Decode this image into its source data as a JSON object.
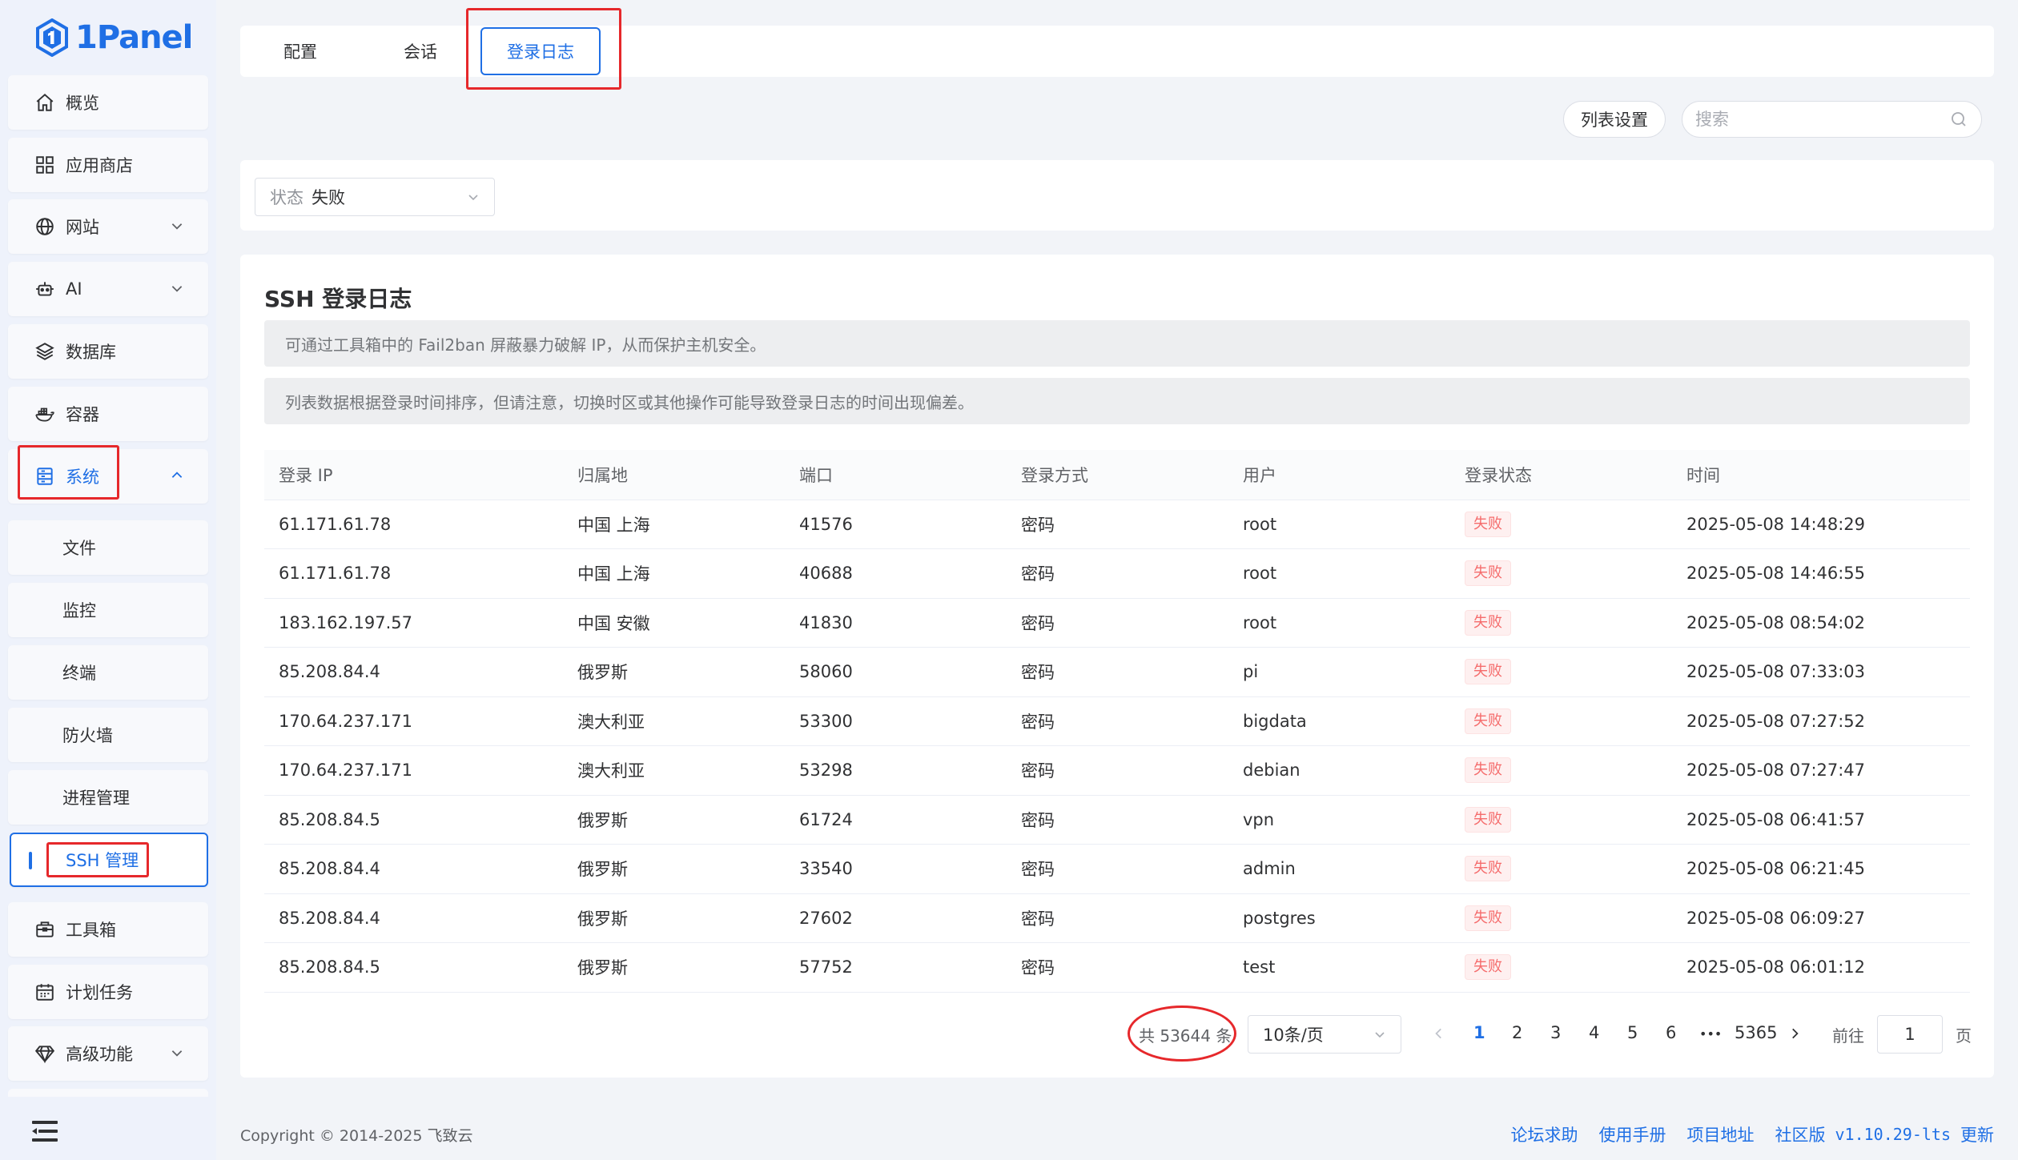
{
  "app": {
    "logo_text": "1Panel",
    "brand_color": "#1f6fe5"
  },
  "sidebar": {
    "items": [
      {
        "label": "概览",
        "icon": "home-icon"
      },
      {
        "label": "应用商店",
        "icon": "grid-icon"
      },
      {
        "label": "网站",
        "icon": "globe-icon",
        "expandable": true
      },
      {
        "label": "AI",
        "icon": "robot-icon",
        "expandable": true
      },
      {
        "label": "数据库",
        "icon": "layers-icon"
      },
      {
        "label": "容器",
        "icon": "docker-icon"
      },
      {
        "label": "系统",
        "icon": "server-icon",
        "expanded": true
      },
      {
        "label": "文件"
      },
      {
        "label": "监控"
      },
      {
        "label": "终端"
      },
      {
        "label": "防火墙"
      },
      {
        "label": "进程管理"
      },
      {
        "label": "SSH 管理",
        "active": true
      },
      {
        "label": "工具箱",
        "icon": "toolbox-icon"
      },
      {
        "label": "计划任务",
        "icon": "calendar-icon"
      },
      {
        "label": "高级功能",
        "icon": "diamond-icon",
        "expandable": true
      }
    ]
  },
  "tabs": [
    {
      "label": "配置"
    },
    {
      "label": "会话"
    },
    {
      "label": "登录日志",
      "active": true
    }
  ],
  "toolbar": {
    "column_settings": "列表设置",
    "search_placeholder": "搜索"
  },
  "filter": {
    "prefix": "状态",
    "value": "失败"
  },
  "main": {
    "title": "SSH 登录日志",
    "notice1": "可通过工具箱中的 Fail2ban 屏蔽暴力破解 IP，从而保护主机安全。",
    "notice2": "列表数据根据登录时间排序，但请注意，切换时区或其他操作可能导致登录日志的时间出现偏差。"
  },
  "table": {
    "columns": [
      "登录 IP",
      "归属地",
      "端口",
      "登录方式",
      "用户",
      "登录状态",
      "时间"
    ],
    "rows": [
      [
        "61.171.61.78",
        "中国 上海",
        "41576",
        "密码",
        "root",
        "失败",
        "2025-05-08 14:48:29"
      ],
      [
        "61.171.61.78",
        "中国 上海",
        "40688",
        "密码",
        "root",
        "失败",
        "2025-05-08 14:46:55"
      ],
      [
        "183.162.197.57",
        "中国 安徽",
        "41830",
        "密码",
        "root",
        "失败",
        "2025-05-08 08:54:02"
      ],
      [
        "85.208.84.4",
        "俄罗斯",
        "58060",
        "密码",
        "pi",
        "失败",
        "2025-05-08 07:33:03"
      ],
      [
        "170.64.237.171",
        "澳大利亚",
        "53300",
        "密码",
        "bigdata",
        "失败",
        "2025-05-08 07:27:52"
      ],
      [
        "170.64.237.171",
        "澳大利亚",
        "53298",
        "密码",
        "debian",
        "失败",
        "2025-05-08 07:27:47"
      ],
      [
        "85.208.84.5",
        "俄罗斯",
        "61724",
        "密码",
        "vpn",
        "失败",
        "2025-05-08 06:41:57"
      ],
      [
        "85.208.84.4",
        "俄罗斯",
        "33540",
        "密码",
        "admin",
        "失败",
        "2025-05-08 06:21:45"
      ],
      [
        "85.208.84.4",
        "俄罗斯",
        "27602",
        "密码",
        "postgres",
        "失败",
        "2025-05-08 06:09:27"
      ],
      [
        "85.208.84.5",
        "俄罗斯",
        "57752",
        "密码",
        "test",
        "失败",
        "2025-05-08 06:01:12"
      ]
    ]
  },
  "pagination": {
    "total": "共 53644 条",
    "page_size": "10条/页",
    "pages": [
      "1",
      "2",
      "3",
      "4",
      "5",
      "6"
    ],
    "ellipsis": "•••",
    "last_page": "5365",
    "current": "1",
    "goto_prefix": "前往",
    "goto_value": "1",
    "goto_suffix": "页"
  },
  "footer": {
    "copyright": "Copyright © 2014-2025 飞致云",
    "links": [
      "论坛求助",
      "使用手册",
      "项目地址",
      "社区版"
    ],
    "version": "v1.10.29-lts",
    "update": "更新"
  }
}
